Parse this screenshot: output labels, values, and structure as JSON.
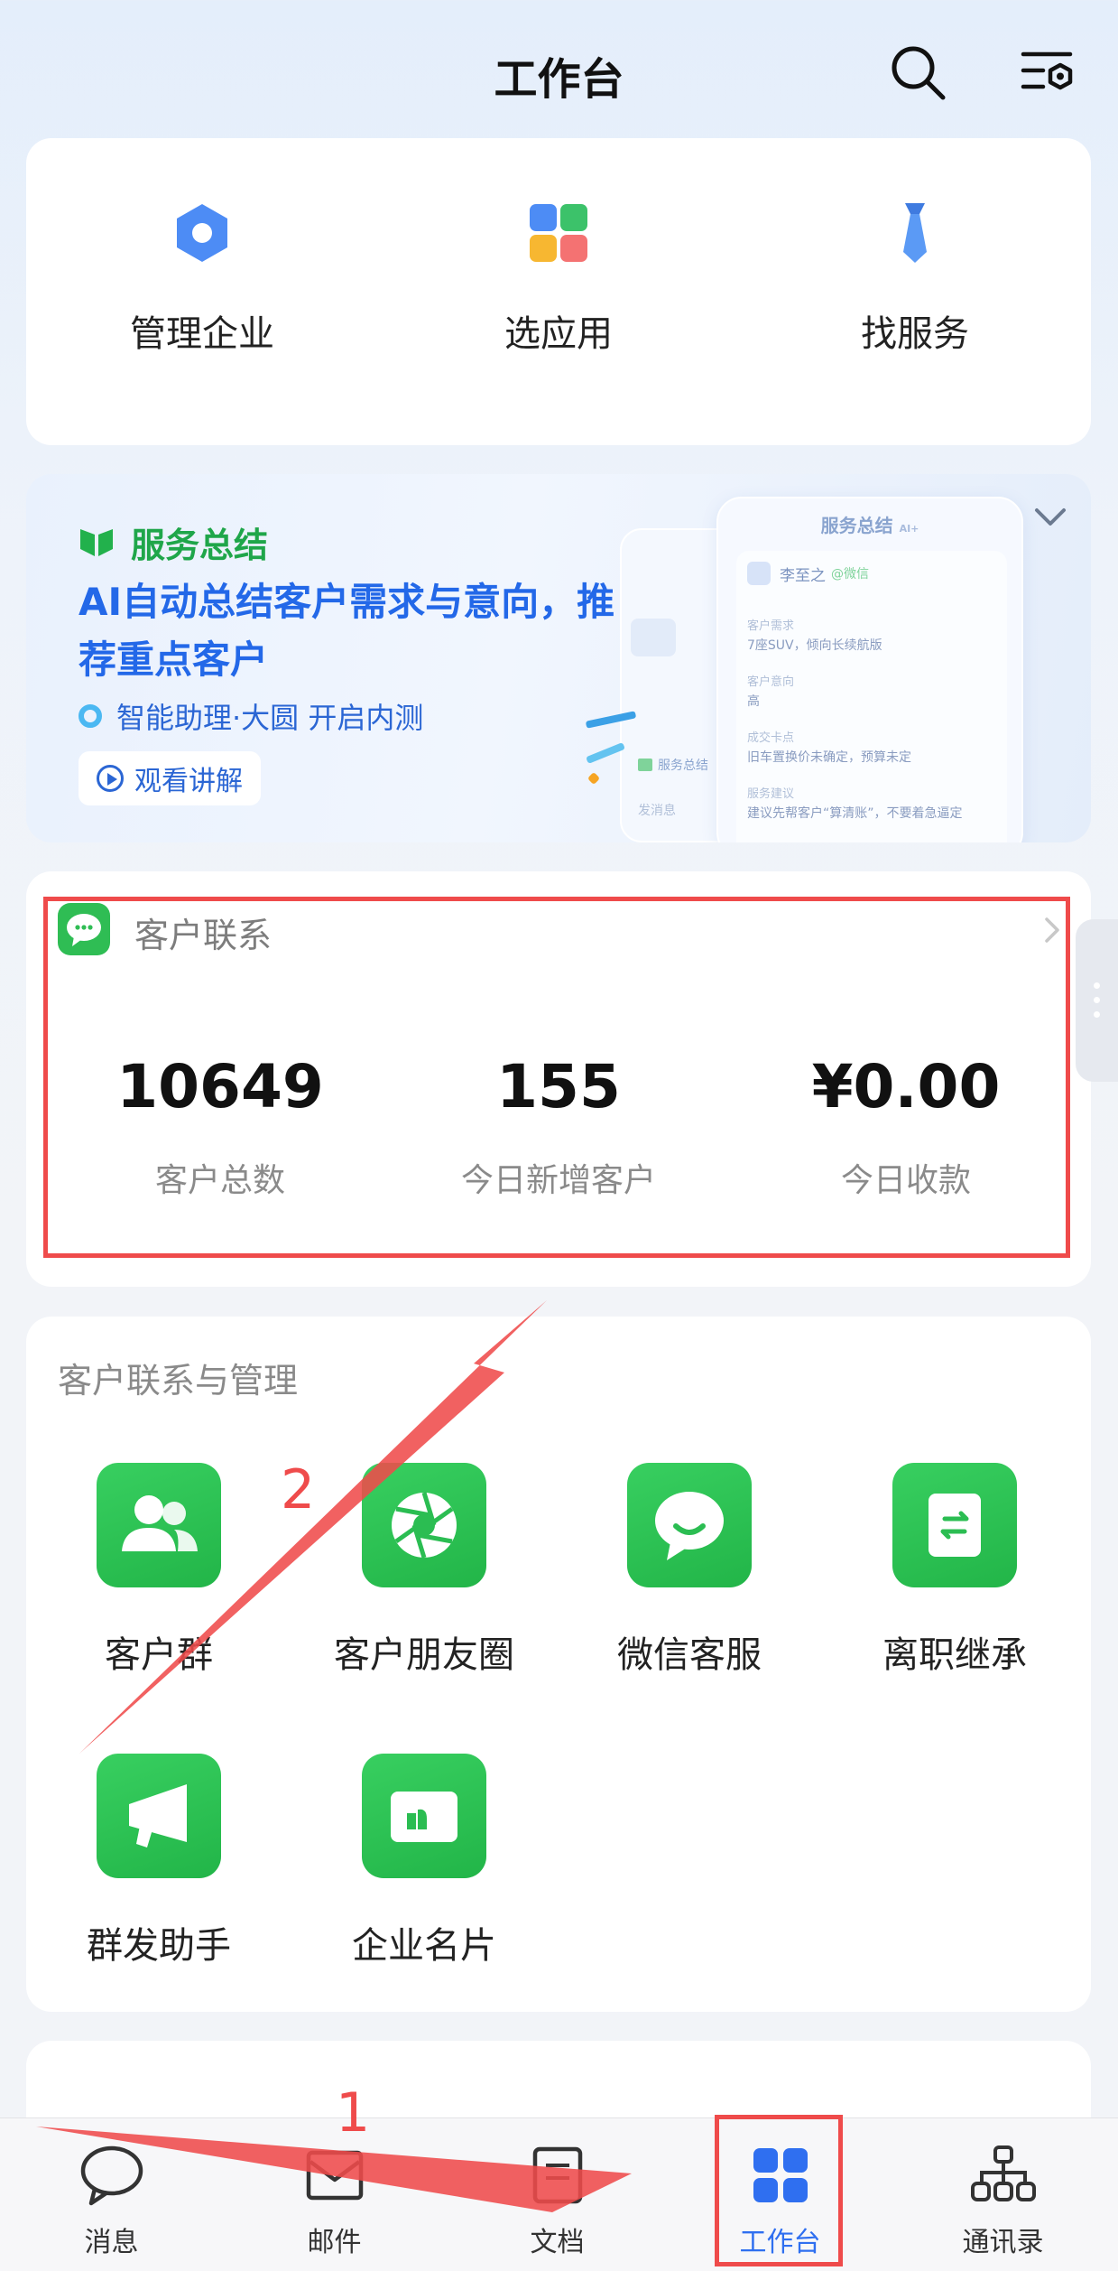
{
  "header": {
    "title": "工作台"
  },
  "quick_actions": [
    {
      "label": "管理企业",
      "icon": "hexagon-icon"
    },
    {
      "label": "选应用",
      "icon": "apps-grid-icon"
    },
    {
      "label": "找服务",
      "icon": "tie-icon"
    }
  ],
  "banner": {
    "brand": "服务总结",
    "headline": "AI自动总结客户需求与意向，推荐重点客户",
    "sub": "智能助理·大圆 开启内测",
    "watch_label": "观看讲解",
    "mock": {
      "title": "服务总结",
      "title_suffix": "AI+",
      "user": "李至之",
      "user_tag": "@微信",
      "fields": [
        {
          "label": "客户需求",
          "value": "7座SUV，倾向长续航版"
        },
        {
          "label": "客户意向",
          "value": "高"
        },
        {
          "label": "成交卡点",
          "value": "旧车置换价未确定，预算未定"
        },
        {
          "label": "服务建议",
          "value": "建议先帮客户“算清账”，不要着急逼定"
        }
      ],
      "back_tag": "服务总结",
      "back_send": "发消息"
    }
  },
  "customer_contact": {
    "title": "客户联系",
    "stats": [
      {
        "value": "10649",
        "label": "客户总数"
      },
      {
        "value": "155",
        "label": "今日新增客户"
      },
      {
        "value": "¥0.00",
        "label": "今日收款"
      }
    ]
  },
  "tools": {
    "title": "客户联系与管理",
    "items": [
      {
        "label": "客户群",
        "icon": "customer-group-icon"
      },
      {
        "label": "客户朋友圈",
        "icon": "moments-shutter-icon"
      },
      {
        "label": "微信客服",
        "icon": "chat-bubble-icon"
      },
      {
        "label": "离职继承",
        "icon": "transfer-icon"
      },
      {
        "label": "群发助手",
        "icon": "megaphone-icon"
      },
      {
        "label": "企业名片",
        "icon": "business-card-icon"
      }
    ]
  },
  "tabbar": [
    {
      "label": "消息",
      "icon": "chat-icon"
    },
    {
      "label": "邮件",
      "icon": "mail-icon"
    },
    {
      "label": "文档",
      "icon": "document-icon"
    },
    {
      "label": "工作台",
      "icon": "workbench-icon",
      "active": true
    },
    {
      "label": "通讯录",
      "icon": "org-chart-icon"
    }
  ],
  "annotations": {
    "step1": "1",
    "step2": "2"
  },
  "colors": {
    "accent": "#2f6ff0",
    "green": "#2fbd54",
    "annotation": "#ef4b4b",
    "banner_text": "#2368e8"
  }
}
